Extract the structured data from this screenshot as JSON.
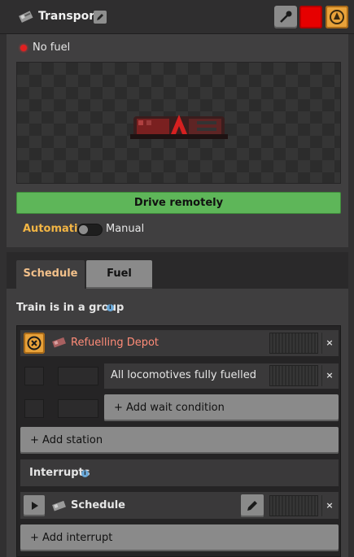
{
  "window": {
    "title": "Transport",
    "icon": "locomotive-icon",
    "buttons": [
      "rename-icon",
      "pipette-icon",
      "color-picker",
      "center-on-entity-icon"
    ],
    "accent_color": "#e60000"
  },
  "status": {
    "text": "No fuel",
    "color": "#e02020"
  },
  "drive_button": {
    "label": "Drive remotely",
    "color": "#5eb659"
  },
  "mode": {
    "automatic_label": "Automatic",
    "manual_label": "Manual",
    "selected": "Manual"
  },
  "tabs": [
    {
      "label": "Schedule",
      "active": true
    },
    {
      "label": "Fuel",
      "active": false
    }
  ],
  "schedule": {
    "group_text": "Train is in a group",
    "info_icon": "info-icon",
    "stations": [
      {
        "name": "Refuelling Depot",
        "name_color": "#ff8c78",
        "icon": "train-stop-icon",
        "conditions": [
          {
            "label": "All locomotives fully fuelled"
          }
        ],
        "add_wait_label": "+ Add wait condition",
        "remove_glyph": "×"
      }
    ],
    "add_station_label": "+ Add station",
    "interrupts": {
      "title": "Interrupts",
      "items": [
        {
          "name": "Schedule",
          "icon": "train-stop-icon",
          "remove_glyph": "×"
        }
      ],
      "add_label": "+ Add interrupt"
    }
  }
}
